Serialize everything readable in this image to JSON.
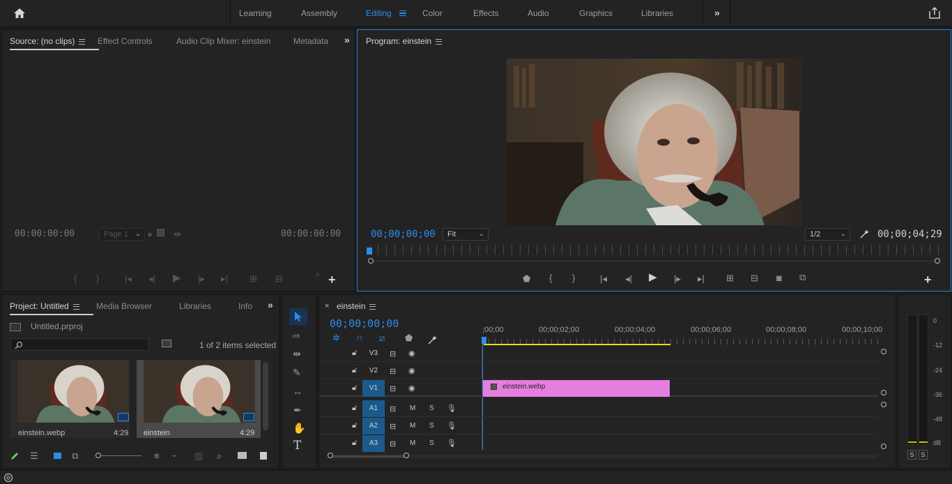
{
  "workspaces": [
    "Learning",
    "Assembly",
    "Editing",
    "Color",
    "Effects",
    "Audio",
    "Graphics",
    "Libraries"
  ],
  "active_workspace": "Editing",
  "source_panel": {
    "tabs": [
      "Source: (no clips)",
      "Effect Controls",
      "Audio Clip Mixer: einstein",
      "Metadata"
    ],
    "timecode_in": "00:00:00:00",
    "page_select": "Page 1",
    "timecode_out": "00:00:00:00"
  },
  "program_panel": {
    "title": "Program: einstein",
    "timecode": "00;00;00;00",
    "fit": "Fit",
    "resolution": "1/2",
    "duration": "00;00;04;29"
  },
  "project_panel": {
    "tabs": [
      "Project: Untitled",
      "Media Browser",
      "Libraries",
      "Info"
    ],
    "file": "Untitled.prproj",
    "selection_status": "1 of 2 items selected",
    "items": [
      {
        "name": "einstein.webp",
        "duration": "4:29"
      },
      {
        "name": "einstein",
        "duration": "4:29"
      }
    ]
  },
  "timeline": {
    "sequence_name": "einstein",
    "timecode": "00;00;00;00",
    "ruler": [
      ";00;00",
      "00;00;02;00",
      "00;00;04;00",
      "00;00;06;00",
      "00;00;08;00",
      "00;00;10;00"
    ],
    "video_tracks": [
      "V3",
      "V2",
      "V1"
    ],
    "audio_tracks": [
      "A1",
      "A2",
      "A3"
    ],
    "mute": "M",
    "solo": "S",
    "clip_name": "einstein.webp",
    "clip_color": "#e47fe0"
  },
  "meter": {
    "scale": [
      "0",
      "-12",
      "-24",
      "-36",
      "-48",
      "dB"
    ],
    "solo_buttons": [
      "S",
      "S"
    ]
  },
  "colors": {
    "accent": "#2d8ceb",
    "panel": "#232323",
    "clip": "#e47fe0",
    "work_area": "#e5e000"
  }
}
